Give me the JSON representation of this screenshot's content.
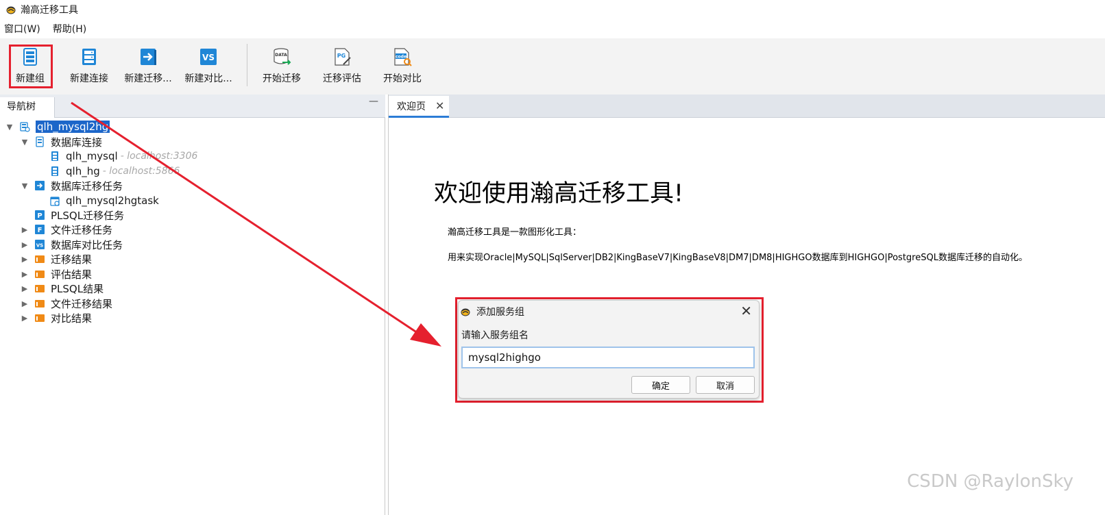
{
  "window": {
    "title": "瀚高迁移工具"
  },
  "menu": [
    {
      "label": "窗口(W)"
    },
    {
      "label": "帮助(H)"
    }
  ],
  "toolbar": {
    "items": [
      {
        "label": "新建组",
        "icon": "server-group-icon"
      },
      {
        "label": "新建连接",
        "icon": "database-connection-icon"
      },
      {
        "label": "新建迁移...",
        "icon": "migration-arrow-icon"
      },
      {
        "label": "新建对比...",
        "icon": "vs-compare-icon"
      },
      {
        "label": "开始迁移",
        "icon": "data-migrate-icon"
      },
      {
        "label": "迁移评估",
        "icon": "pg-evaluate-icon"
      },
      {
        "label": "开始对比",
        "icon": "code-compare-icon"
      }
    ]
  },
  "nav": {
    "tab_label": "导航树",
    "minimize": "—",
    "tree": [
      {
        "label": "qlh_mysql2hg",
        "host": "",
        "selected": true,
        "expanded": true
      },
      {
        "label": "数据库连接",
        "host": ""
      },
      {
        "label": "qlh_mysql",
        "host": "- localhost:3306"
      },
      {
        "label": "qlh_hg",
        "host": "- localhost:5866"
      },
      {
        "label": "数据库迁移任务",
        "host": ""
      },
      {
        "label": "qlh_mysql2hgtask",
        "host": ""
      },
      {
        "label": "PLSQL迁移任务",
        "host": ""
      },
      {
        "label": "文件迁移任务",
        "host": ""
      },
      {
        "label": "数据库对比任务",
        "host": ""
      },
      {
        "label": "迁移结果",
        "host": ""
      },
      {
        "label": "评估结果",
        "host": ""
      },
      {
        "label": "PLSQL结果",
        "host": ""
      },
      {
        "label": "文件迁移结果",
        "host": ""
      },
      {
        "label": "对比结果",
        "host": ""
      }
    ]
  },
  "main": {
    "tab_label": "欢迎页",
    "tab_close": "✕",
    "welcome_title": "欢迎使用瀚高迁移工具!",
    "welcome_line1": "瀚高迁移工具是一款图形化工具：",
    "welcome_line2": "用来实现Oracle|MySQL|SqlServer|DB2|KingBaseV7|KingBaseV8|DM7|DM8|HIGHGO数据库到HIGHGO|PostgreSQL数据库迁移的自动化。"
  },
  "dialog": {
    "title": "添加服务组",
    "close": "✕",
    "prompt": "请输入服务组名",
    "input_value": "mysql2highgo",
    "ok_label": "确定",
    "cancel_label": "取消"
  },
  "watermark": "CSDN @RaylonSky",
  "colors": {
    "annotation_red": "#e5202e",
    "selection_blue": "#1c66c9",
    "icon_blue": "#1f86d6",
    "folder_orange": "#f08a16"
  }
}
